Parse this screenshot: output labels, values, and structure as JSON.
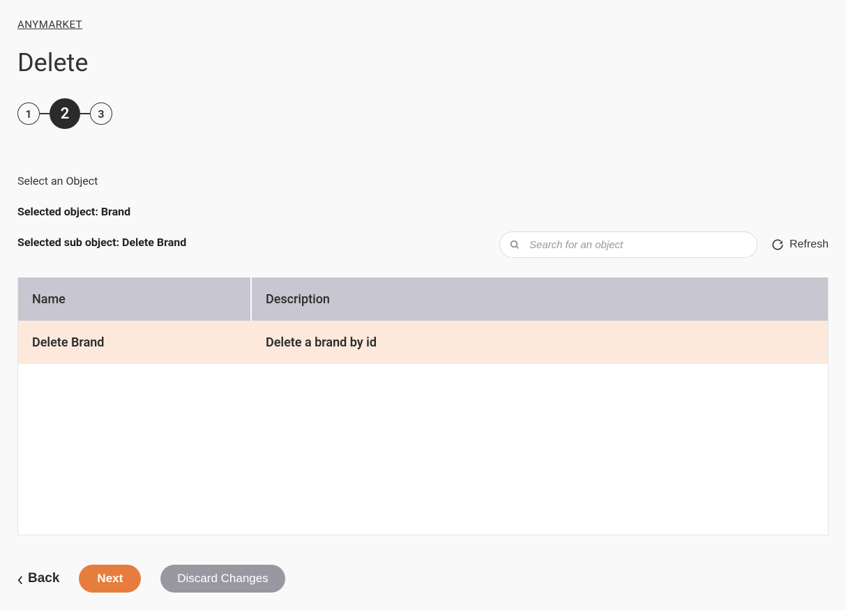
{
  "breadcrumb": {
    "label": "ANYMARKET"
  },
  "page": {
    "title": "Delete"
  },
  "stepper": {
    "steps": [
      "1",
      "2",
      "3"
    ],
    "active_index": 1
  },
  "section": {
    "label": "Select an Object",
    "selected_object_label": "Selected object: Brand",
    "selected_sub_object_label": "Selected sub object: Delete Brand"
  },
  "search": {
    "placeholder": "Search for an object",
    "value": ""
  },
  "refresh": {
    "label": "Refresh"
  },
  "table": {
    "headers": {
      "name": "Name",
      "description": "Description"
    },
    "rows": [
      {
        "name": "Delete Brand",
        "description": "Delete a brand by id"
      }
    ]
  },
  "actions": {
    "back": "Back",
    "next": "Next",
    "discard": "Discard Changes"
  }
}
